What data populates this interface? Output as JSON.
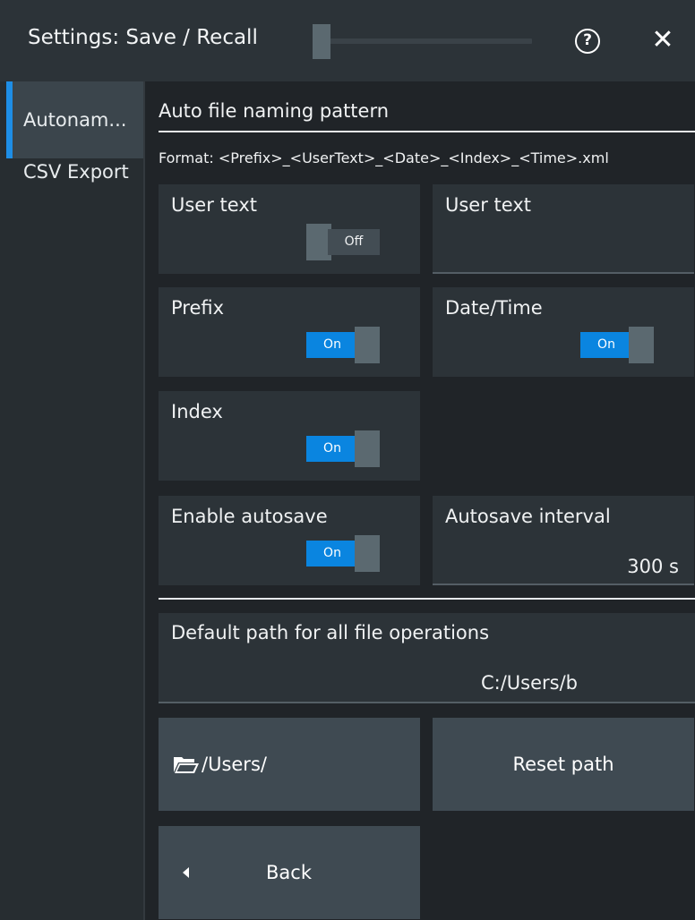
{
  "header": {
    "title": "Settings: Save / Recall",
    "help_icon": "question-circle-icon",
    "help_glyph": "?",
    "close_icon": "close-icon",
    "close_glyph": "✕"
  },
  "sidebar": {
    "items": [
      {
        "label": "Autonam...",
        "active": true
      },
      {
        "label": "CSV Export",
        "active": false
      }
    ]
  },
  "section": {
    "title": "Auto file naming pattern",
    "format": "Format: <Prefix>_<UserText>_<Date>_<Index>_<Time>.xml"
  },
  "user_text_toggle": {
    "label": "User text",
    "state": "Off"
  },
  "user_text_field": {
    "label": "User text",
    "value": ""
  },
  "prefix_toggle": {
    "label": "Prefix",
    "state": "On"
  },
  "datetime_toggle": {
    "label": "Date/Time",
    "state": "On"
  },
  "index_toggle": {
    "label": "Index",
    "state": "On"
  },
  "autosave_toggle": {
    "label": "Enable autosave",
    "state": "On"
  },
  "autosave_interval": {
    "label": "Autosave interval",
    "value": "300 s"
  },
  "default_path": {
    "label": "Default path for all file operations",
    "value": "C:/Users/b"
  },
  "buttons": {
    "browse_label": "/Users/",
    "browse_icon": "folder-open-icon",
    "reset_label": "Reset path",
    "back_label": "Back",
    "back_icon": "triangle-left-icon"
  },
  "colors": {
    "accent": "#0a85e0",
    "sidebar_accent": "#1e8ee6",
    "background": "#202428"
  }
}
